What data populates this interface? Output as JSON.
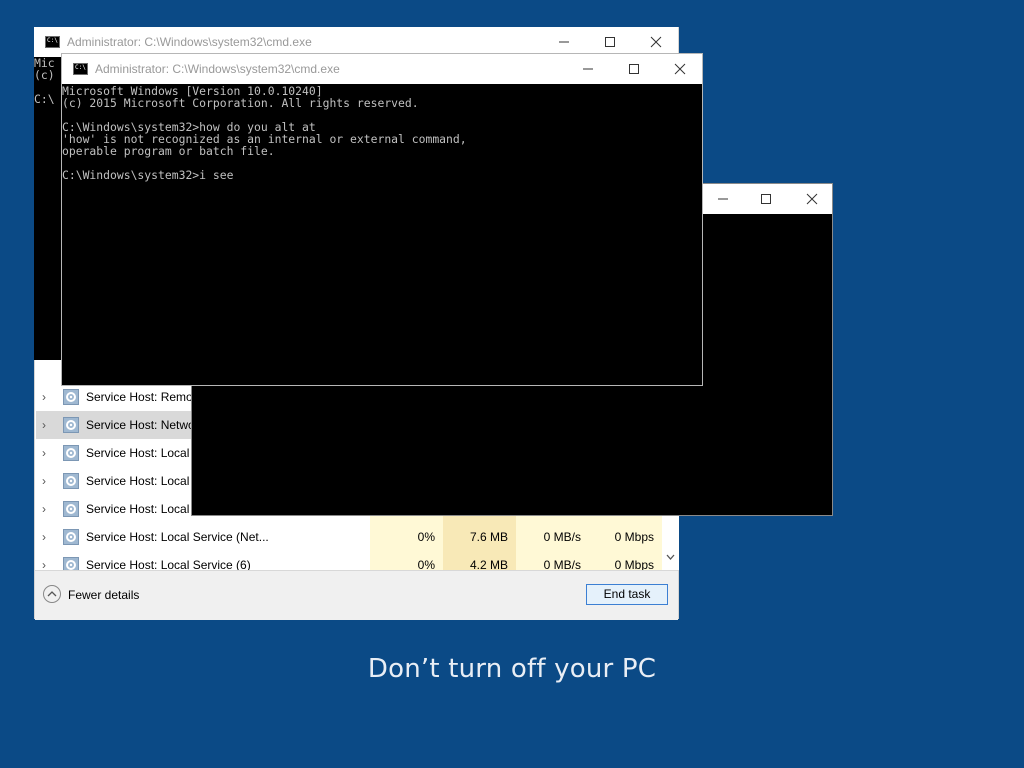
{
  "taskmgr": {
    "rows": [
      {
        "name": "Service Host: Remot"
      },
      {
        "name": "Service Host: Netwo",
        "selected": true
      },
      {
        "name": "Service Host: Local S"
      },
      {
        "name": "Service Host: Local S"
      },
      {
        "name": "Service Host: Local S"
      },
      {
        "name": "Service Host: Local Service (Net...",
        "cpu": "0%",
        "memory": "7.6 MB",
        "disk": "0 MB/s",
        "network": "0 Mbps"
      },
      {
        "name": "Service Host: Local Service (6)",
        "cpu": "0%",
        "memory": "4.2 MB",
        "disk": "0 MB/s",
        "network": "0 Mbps"
      }
    ],
    "fewer_details": "Fewer details",
    "end_task": "End task"
  },
  "cmd_mid": {
    "title": "Administrator: C:\\Windows\\system32\\cmd.exe",
    "visible_text": "Mic\n(c)\n\nC:\\"
  },
  "cmd_front": {
    "title": "Administrator: C:\\Windows\\system32\\cmd.exe",
    "lines": "Microsoft Windows [Version 10.0.10240]\n(c) 2015 Microsoft Corporation. All rights reserved.\n\nC:\\Windows\\system32>how do you alt at\n'how' is not recognized as an internal or external command,\noperable program or batch file.\n\nC:\\Windows\\system32>i see"
  },
  "icon_label": "C:\\",
  "bottom_message": "Don’t turn off your PC",
  "colors": {
    "desktop": "#0b4a86",
    "console_bg": "#000000",
    "console_text": "#c0c0c0",
    "highlight_cell": "#fff9d6",
    "memory_cell": "#f8e9b7",
    "button_border": "#3c7fd3"
  }
}
